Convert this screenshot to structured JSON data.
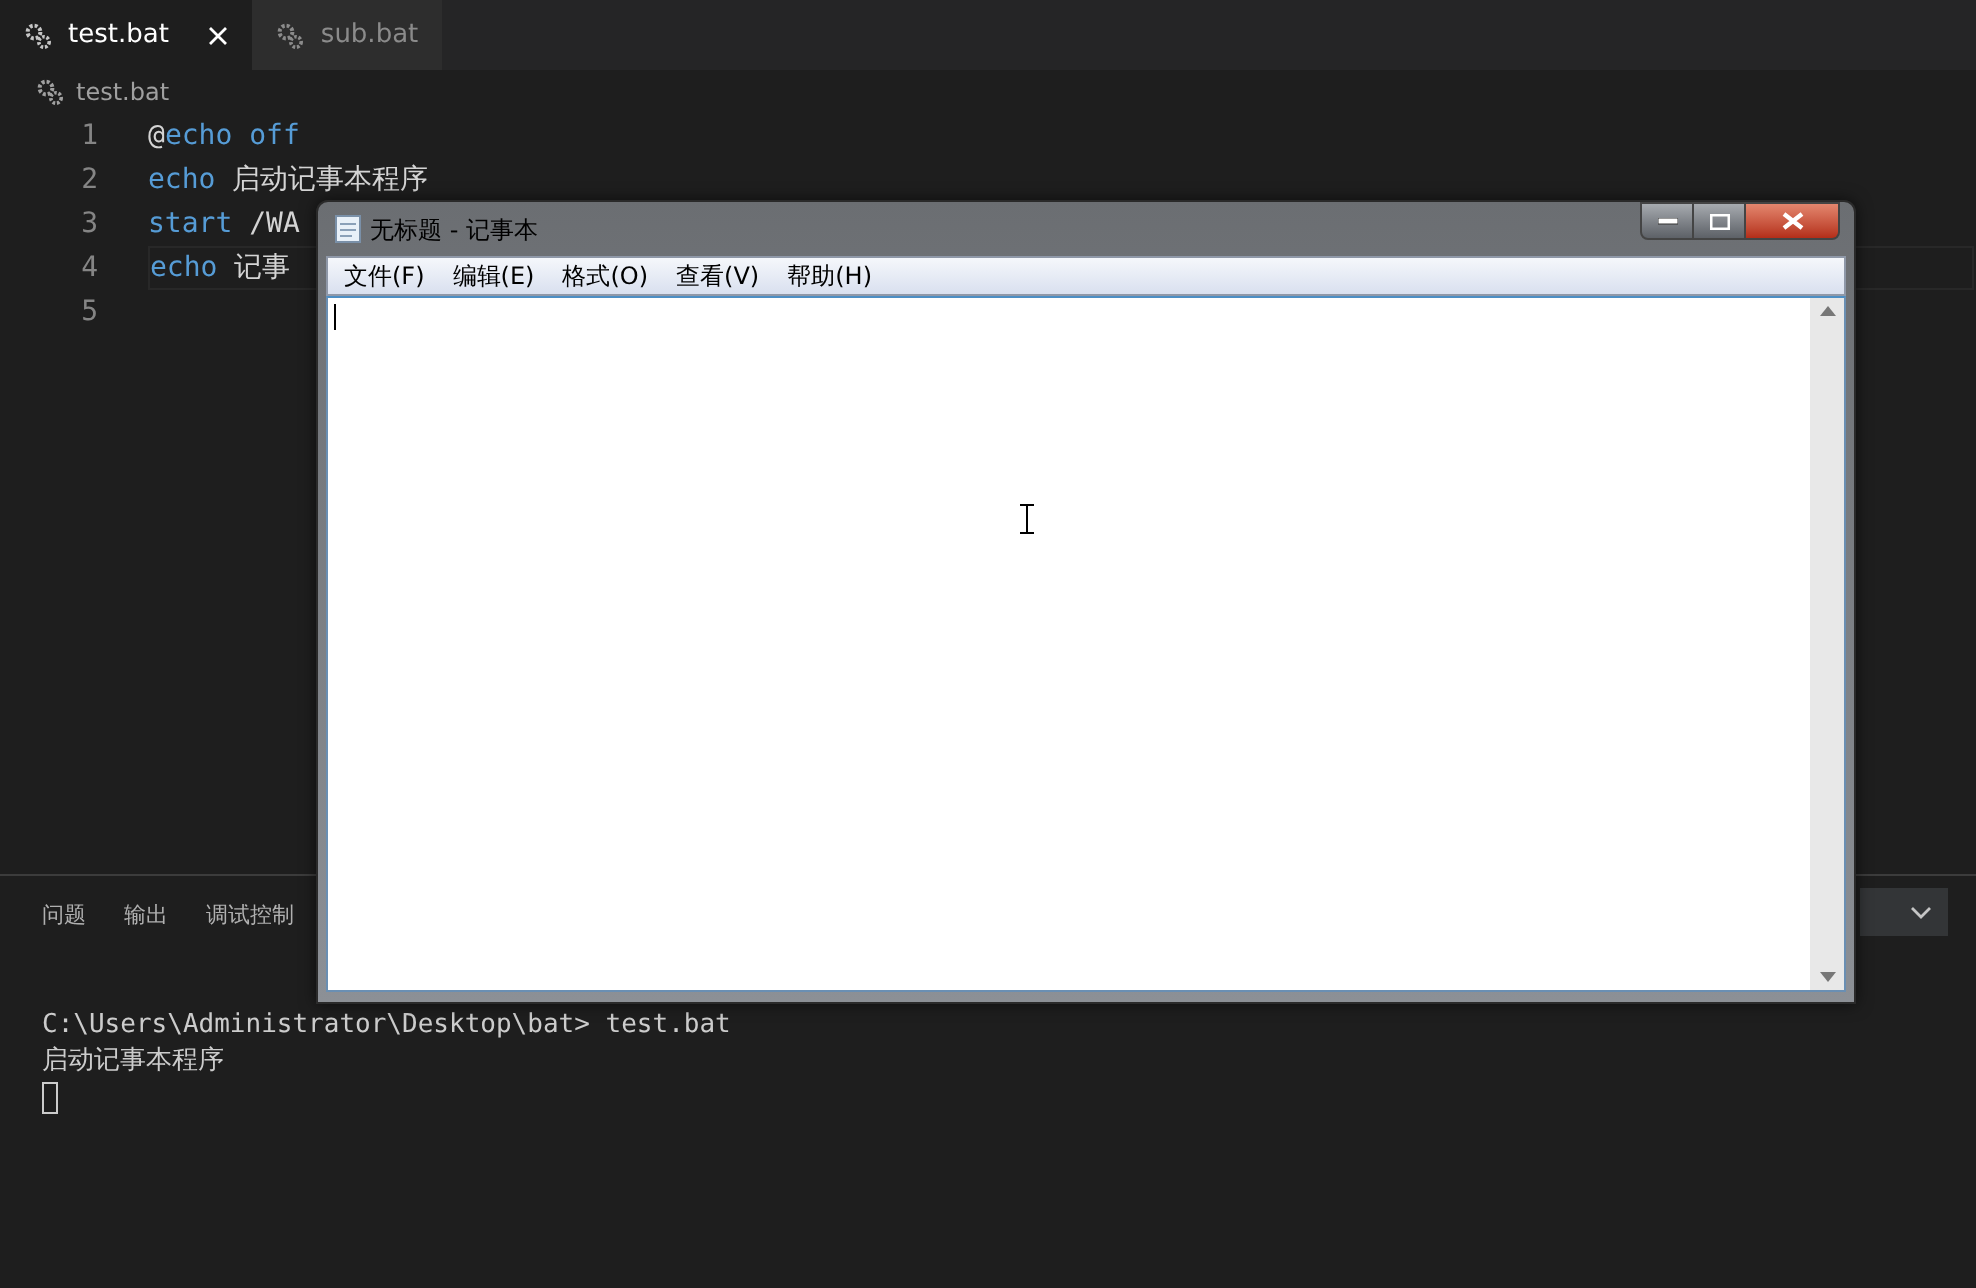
{
  "tabs": [
    {
      "label": "test.bat",
      "selected": true,
      "closable": true
    },
    {
      "label": "sub.bat",
      "selected": false,
      "closable": false
    }
  ],
  "breadcrumb": "test.bat",
  "editor": {
    "lines": [
      {
        "number": "1",
        "tokens": [
          {
            "text": "@",
            "kind": "plain"
          },
          {
            "text": "echo off",
            "kind": "keyword"
          }
        ],
        "current": false
      },
      {
        "number": "2",
        "tokens": [
          {
            "text": "echo",
            "kind": "keyword"
          },
          {
            "text": " 启动记事本程序",
            "kind": "plain"
          }
        ],
        "current": false
      },
      {
        "number": "3",
        "tokens": [
          {
            "text": "start",
            "kind": "keyword"
          },
          {
            "text": " /WA",
            "kind": "plain"
          }
        ],
        "current": false
      },
      {
        "number": "4",
        "tokens": [
          {
            "text": "echo",
            "kind": "keyword"
          },
          {
            "text": " 记事",
            "kind": "plain"
          }
        ],
        "current": true
      },
      {
        "number": "5",
        "current": false
      }
    ]
  },
  "panel": {
    "tabs": [
      {
        "label": "问题",
        "selected": false
      },
      {
        "label": "输出",
        "selected": false
      },
      {
        "label": "调试控制",
        "selected": false
      }
    ],
    "terminal_lines": [
      "C:\\Users\\Administrator\\Desktop\\bat> test.bat",
      "启动记事本程序"
    ]
  },
  "notepad": {
    "title": "无标题 - 记事本",
    "menu": [
      "文件(F)",
      "编辑(E)",
      "格式(O)",
      "查看(V)",
      "帮助(H)"
    ]
  }
}
